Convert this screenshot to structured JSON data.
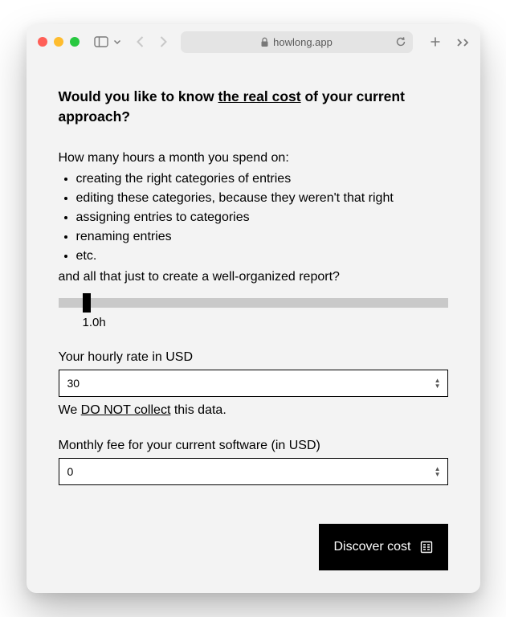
{
  "browser": {
    "url_host": "howlong.app"
  },
  "heading": {
    "prefix": "Would you like to know ",
    "emph": "the real cost",
    "suffix": " of your current approach?"
  },
  "intro": "How many hours a month you spend on:",
  "tasks": [
    "creating the right categories of entries",
    "editing these categories, because they weren't that right",
    "assigning entries to categories",
    "renaming entries",
    "etc."
  ],
  "outro": "and all that just to create a well-organized report?",
  "slider": {
    "value_label": "1.0h"
  },
  "rate": {
    "label": "Your hourly rate in USD",
    "value": "30"
  },
  "disclaimer": {
    "prefix": "We ",
    "mid": "DO NOT collect",
    "suffix": " this data."
  },
  "fee": {
    "label": "Monthly fee for your current software (in USD)",
    "value": "0"
  },
  "cta": "Discover cost"
}
